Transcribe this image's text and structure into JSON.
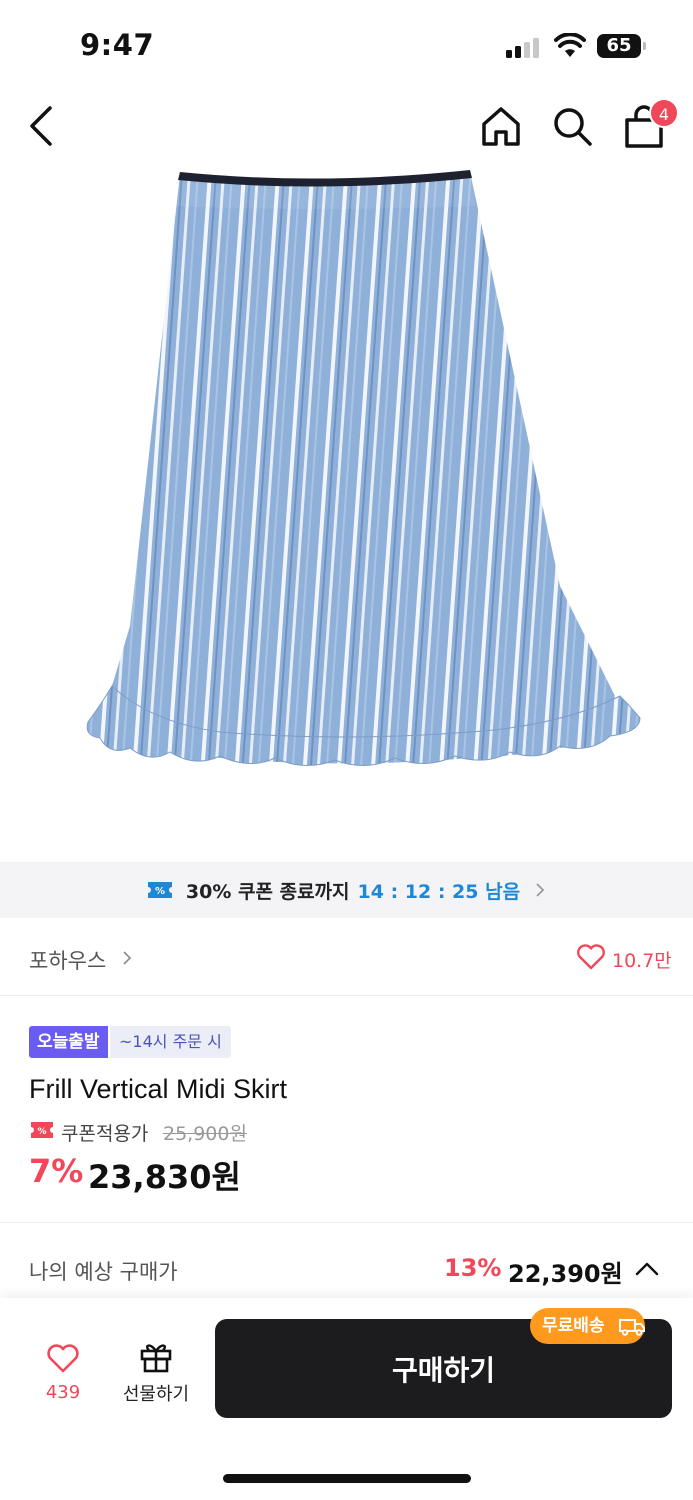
{
  "status_bar": {
    "time": "9:47",
    "battery": "65"
  },
  "nav": {
    "cart_count": "4",
    "icons": [
      "back-icon",
      "home-icon",
      "search-icon",
      "cart-icon"
    ]
  },
  "coupon_timer": {
    "text": "30% 쿠폰 종료까지",
    "countdown": "14 : 12 : 25 남음"
  },
  "brand": {
    "name": "포하우스",
    "likes": "10.7만"
  },
  "product": {
    "today_ship_badge": "오늘출발",
    "order_by_badge": "~14시 주문 시",
    "name": "Frill Vertical Midi Skirt",
    "coupon_price_label": "쿠폰적용가",
    "original_price": "25,900원",
    "discount_rate": "7%",
    "sale_price": "23,830원"
  },
  "expected": {
    "label": "나의 예상 구매가",
    "rate": "13%",
    "price": "22,390원"
  },
  "bottom_bar": {
    "wish_count": "439",
    "gift_label": "선물하기",
    "buy_label": "구매하기",
    "free_shipping": "무료배송"
  },
  "colors": {
    "accent_red": "#f0485a",
    "timer_blue": "#1e88d6",
    "badge_purple": "#6a5cf0",
    "free_ship_orange": "#ff9a1f",
    "buy_button": "#1c1c1e",
    "skirt_blue": "#8fb0d9"
  }
}
